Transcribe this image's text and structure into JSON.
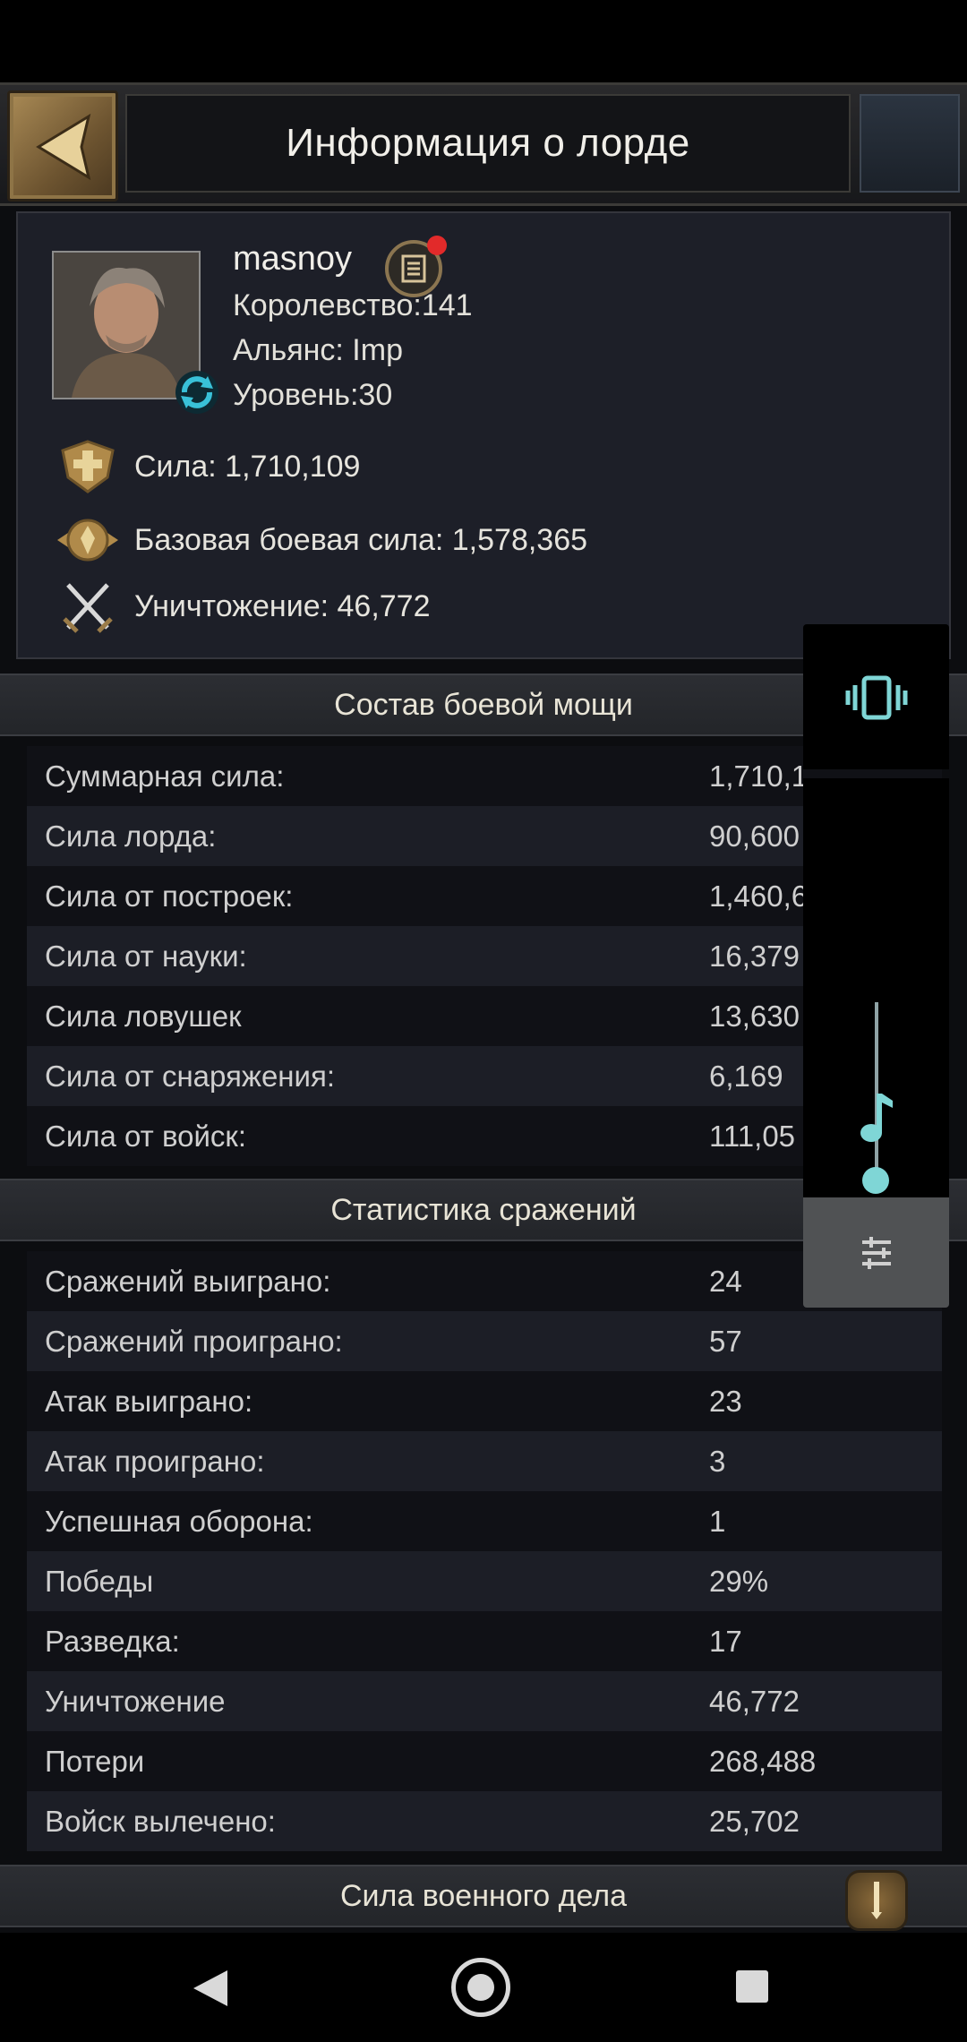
{
  "header": {
    "title": "Информация о лорде"
  },
  "profile": {
    "username": "masnoy",
    "kingdom": "Королевство:141",
    "alliance": "Альянс: Imp",
    "level": "Уровень:30",
    "stats": [
      {
        "icon": "power-shield-icon",
        "text": "Сила: 1,710,109"
      },
      {
        "icon": "combat-emblem-icon",
        "text": "Базовая боевая сила: 1,578,365"
      },
      {
        "icon": "crossed-swords-icon",
        "text": "Уничтожение: 46,772"
      }
    ]
  },
  "power_section": {
    "title": "Состав боевой мощи",
    "rows": [
      {
        "label": "Суммарная сила:",
        "value": "1,710,1"
      },
      {
        "label": "Сила лорда:",
        "value": "90,600"
      },
      {
        "label": "Сила от построек:",
        "value": "1,460,6"
      },
      {
        "label": "Сила от науки:",
        "value": "16,379"
      },
      {
        "label": "Сила ловушек",
        "value": "13,630"
      },
      {
        "label": "Сила от снаряжения:",
        "value": "6,169"
      },
      {
        "label": "Сила от войск:",
        "value": "111,05"
      }
    ]
  },
  "battle_section": {
    "title": "Статистика сражений",
    "rows": [
      {
        "label": "Сражений выиграно:",
        "value": "24"
      },
      {
        "label": "Сражений проиграно:",
        "value": "57"
      },
      {
        "label": "Атак выиграно:",
        "value": "23"
      },
      {
        "label": "Атак проиграно:",
        "value": "3"
      },
      {
        "label": "Успешная оборона:",
        "value": "1"
      },
      {
        "label": "Победы",
        "value": "29%"
      },
      {
        "label": "Разведка:",
        "value": "17"
      },
      {
        "label": "Уничтожение",
        "value": "46,772"
      },
      {
        "label": "Потери",
        "value": "268,488"
      },
      {
        "label": "Войск вылечено:",
        "value": "25,702"
      }
    ]
  },
  "military_section": {
    "title": "Сила военного дела"
  },
  "volume_overlay": {
    "level": 0.05,
    "accent": "#7fd6d6",
    "icons": [
      "vibrate-icon",
      "music-note-icon",
      "equalizer-settings-icon"
    ]
  }
}
